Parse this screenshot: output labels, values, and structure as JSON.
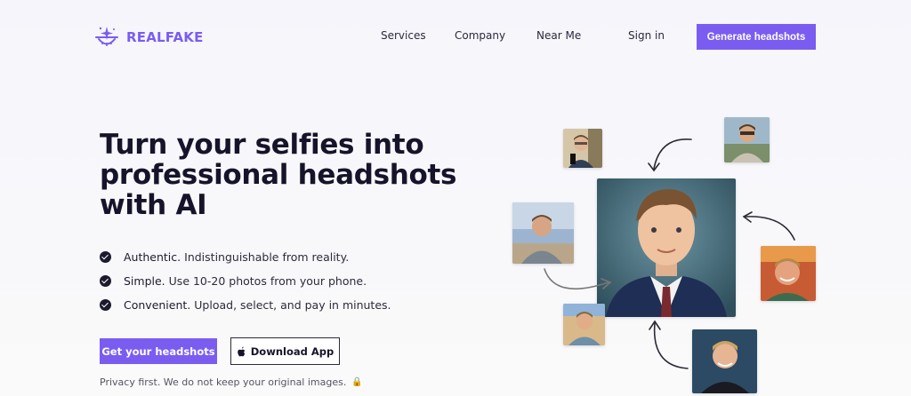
{
  "header": {
    "brand": "REALFAKE",
    "nav": [
      "Services",
      "Company",
      "Near Me"
    ],
    "signin": "Sign in",
    "cta": "Generate headshots"
  },
  "hero": {
    "title": "Turn your selfies into professional headshots with AI",
    "features": [
      {
        "bold": "Authentic.",
        "text": "Indistinguishable from reality."
      },
      {
        "bold": "Simple.",
        "text": "Use 10-20 photos from your phone."
      },
      {
        "bold": "Convenient.",
        "text": "Upload, select, and pay in minutes."
      }
    ],
    "primary_button": "Get your headshots",
    "secondary_button": "Download App",
    "privacy": "Privacy first. We do not keep your original images."
  },
  "colors": {
    "accent": "#7b5cf0",
    "text_dark": "#16142a"
  },
  "icons": [
    "logo-mark-icon",
    "check-icon",
    "apple-icon",
    "lock-icon",
    "curved-arrow-icon"
  ]
}
